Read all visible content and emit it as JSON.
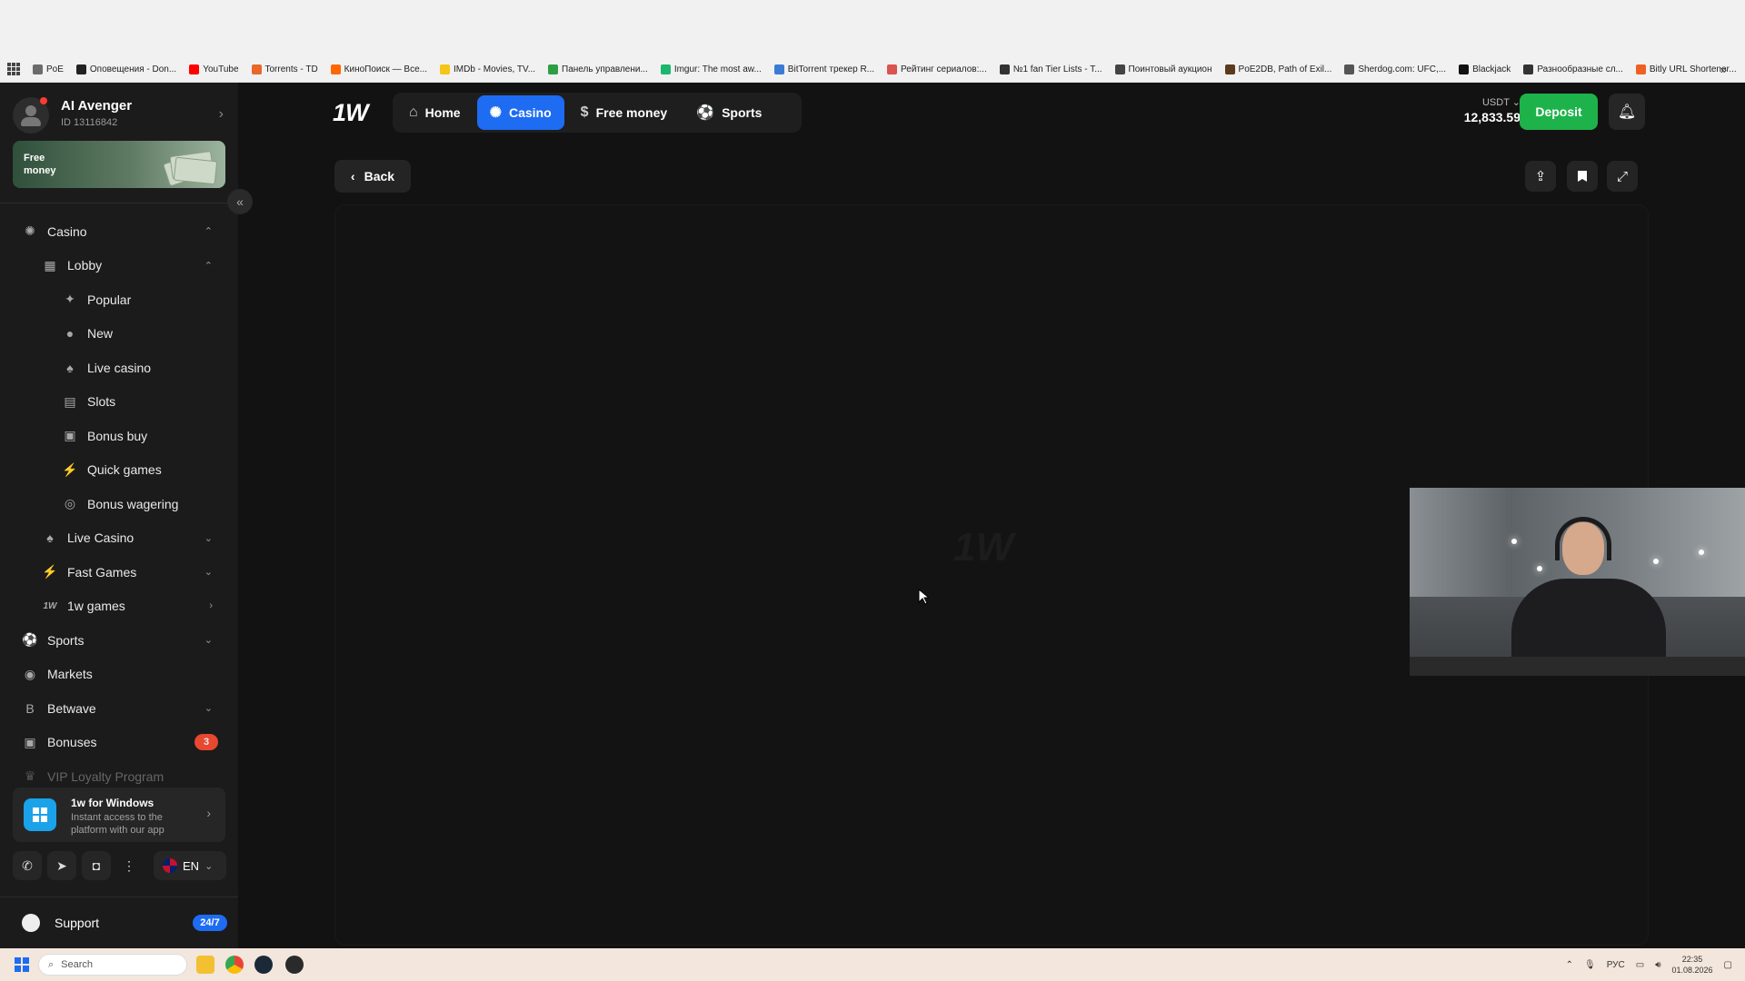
{
  "bookmarks": [
    {
      "label": "PoE",
      "color": "#6b6b6b"
    },
    {
      "label": "Оповещения - Don...",
      "color": "#222222"
    },
    {
      "label": "YouTube",
      "color": "#ff0000"
    },
    {
      "label": "Torrents - TD",
      "color": "#e8672a"
    },
    {
      "label": "КиноПоиск — Все...",
      "color": "#ff6600"
    },
    {
      "label": "IMDb - Movies, TV...",
      "color": "#f5c518"
    },
    {
      "label": "Панель управлени...",
      "color": "#2e9e44"
    },
    {
      "label": "Imgur: The most aw...",
      "color": "#1bb76e"
    },
    {
      "label": "BitTorrent трекер R...",
      "color": "#3a7bd5"
    },
    {
      "label": "Рейтинг сериалов:...",
      "color": "#d9534f"
    },
    {
      "label": "№1 fan Tier Lists - T...",
      "color": "#333333"
    },
    {
      "label": "Поинтовый аукцион",
      "color": "#444444"
    },
    {
      "label": "PoE2DB, Path of Exil...",
      "color": "#5a3b1e"
    },
    {
      "label": "Sherdog.com: UFC,...",
      "color": "#555555"
    },
    {
      "label": "Blackjack",
      "color": "#111111"
    },
    {
      "label": "Разнообразные сл...",
      "color": "#333333"
    },
    {
      "label": "Bitly URL Shortener...",
      "color": "#ee6123"
    }
  ],
  "profile": {
    "name": "AI Avenger",
    "id": "ID 13116842"
  },
  "free_card": {
    "label": "Free money"
  },
  "menu": [
    {
      "label": "Casino",
      "level": 1,
      "icon": "casino-chip-icon",
      "glyph": "✺",
      "chev": "⌃"
    },
    {
      "label": "Lobby",
      "level": 2,
      "icon": "grid-icon",
      "glyph": "▦",
      "chev": "⌃"
    },
    {
      "label": "Popular",
      "level": 3,
      "icon": "sparkle-icon",
      "glyph": "✦"
    },
    {
      "label": "New",
      "level": 3,
      "icon": "new-badge-icon",
      "glyph": "●"
    },
    {
      "label": "Live casino",
      "level": 3,
      "icon": "spade-icon",
      "glyph": "♠"
    },
    {
      "label": "Slots",
      "level": 3,
      "icon": "slot-machine-icon",
      "glyph": "▤"
    },
    {
      "label": "Bonus buy",
      "level": 3,
      "icon": "gift-icon",
      "glyph": "▣"
    },
    {
      "label": "Quick games",
      "level": 3,
      "icon": "lightning-icon",
      "glyph": "⚡"
    },
    {
      "label": "Bonus wagering",
      "level": 3,
      "icon": "wager-icon",
      "glyph": "◎"
    },
    {
      "label": "Live Casino",
      "level": 2,
      "icon": "spade-icon",
      "glyph": "♠",
      "chev": "⌄"
    },
    {
      "label": "Fast Games",
      "level": 2,
      "icon": "lightning-icon",
      "glyph": "⚡",
      "chev": "⌄"
    },
    {
      "label": "1w games",
      "level": 2,
      "icon": "1w-logo-icon",
      "glyph": "1W",
      "chev": "›"
    },
    {
      "label": "Sports",
      "level": 1,
      "icon": "soccer-ball-icon",
      "glyph": "⚽",
      "chev": "⌄"
    },
    {
      "label": "Markets",
      "level": 1,
      "icon": "markets-icon",
      "glyph": "◉"
    },
    {
      "label": "Betwave",
      "level": 1,
      "icon": "betwave-icon",
      "glyph": "B",
      "chev": "⌄"
    },
    {
      "label": "Bonuses",
      "level": 1,
      "icon": "gift-icon",
      "glyph": "▣",
      "badge": "3"
    },
    {
      "label": "VIP Loyalty Program",
      "level": 1,
      "icon": "trophy-icon",
      "glyph": "♛",
      "dim": true
    }
  ],
  "windows_card": {
    "title": "1w for Windows",
    "subtitle": "Instant access to the platform with our app"
  },
  "language": "EN",
  "support": {
    "label": "Support",
    "badge": "24/7"
  },
  "nav": {
    "logo": "1W",
    "tabs": [
      {
        "label": "Home",
        "icon": "home-icon",
        "glyph": "⌂",
        "active": false
      },
      {
        "label": "Casino",
        "icon": "casino-chip-icon",
        "glyph": "✺",
        "active": true
      },
      {
        "label": "Free money",
        "icon": "dollar-coin-icon",
        "glyph": "$",
        "active": false
      },
      {
        "label": "Sports",
        "icon": "soccer-ball-icon",
        "glyph": "⚽",
        "active": false
      }
    ]
  },
  "balance": {
    "currency": "USDT",
    "amount": "12,833.59"
  },
  "deposit_label": "Deposit",
  "back_label": "Back",
  "watermark": "1W",
  "taskbar": {
    "search_placeholder": "Search",
    "lang": "РУС",
    "time": "22:35",
    "date": "01.08.2026"
  }
}
